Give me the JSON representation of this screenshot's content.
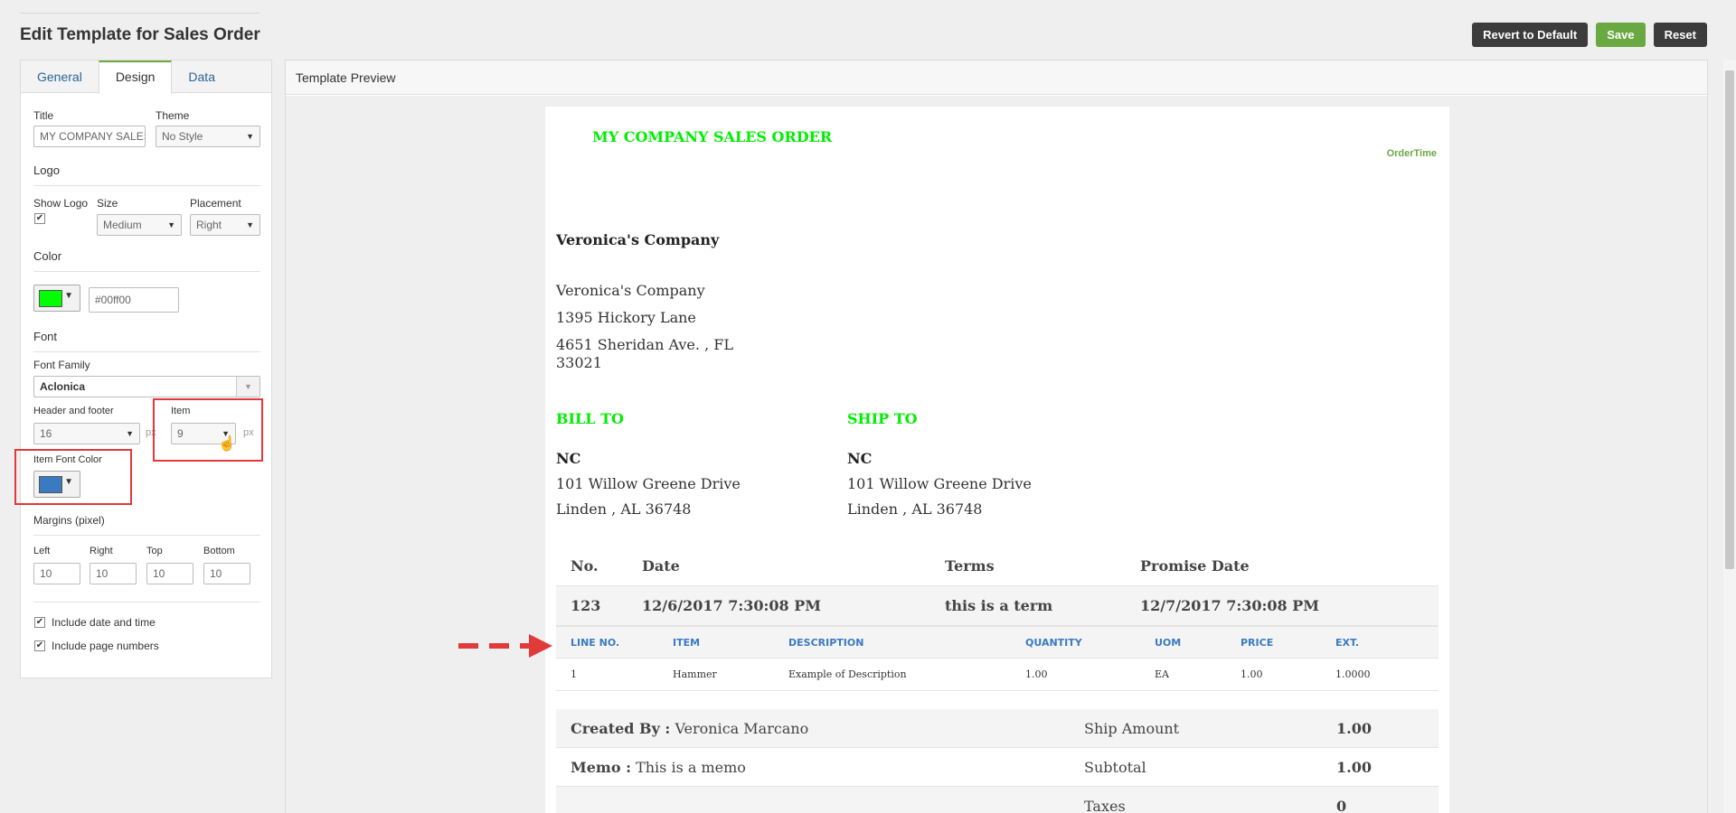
{
  "page": {
    "title": "Edit Template for Sales Order"
  },
  "toolbar": {
    "revert_label": "Revert to Default",
    "save_label": "Save",
    "reset_label": "Reset"
  },
  "tabs": [
    {
      "label": "General"
    },
    {
      "label": "Design"
    },
    {
      "label": "Data"
    }
  ],
  "design": {
    "title_label": "Title",
    "title_value": "MY COMPANY SALES ORDER",
    "theme_label": "Theme",
    "theme_value": "No Style",
    "logo_section": "Logo",
    "show_logo_label": "Show Logo",
    "size_label": "Size",
    "size_value": "Medium",
    "placement_label": "Placement",
    "placement_value": "Right",
    "color_section": "Color",
    "color_hex": "#00ff00",
    "font_section": "Font",
    "font_family_label": "Font Family",
    "font_family_value": "Aclonica",
    "header_footer_label": "Header and footer",
    "header_footer_value": "16",
    "item_label": "Item",
    "item_value": "9",
    "px_unit": "px",
    "item_font_color_label": "Item Font Color",
    "item_font_color": "#3a7ac0",
    "margins_section": "Margins (pixel)",
    "margin_left_label": "Left",
    "margin_right_label": "Right",
    "margin_top_label": "Top",
    "margin_bottom_label": "Bottom",
    "margin_left": "10",
    "margin_right": "10",
    "margin_top": "10",
    "margin_bottom": "10",
    "include_date_label": "Include date and time",
    "include_pages_label": "Include page numbers"
  },
  "preview": {
    "header": "Template Preview",
    "doc_title": "MY COMPANY SALES ORDER",
    "logo_text_a": "OrderTime",
    "company_name": "Veronica's Company",
    "company_addr_1": "Veronica's Company",
    "company_addr_2": "1395 Hickory Lane",
    "company_addr_3": "4651 Sheridan Ave. , FL",
    "company_addr_4": "33021",
    "bill_to": "BILL TO",
    "ship_to": "SHIP TO",
    "bill_name": "NC",
    "bill_line1": "101 Willow Greene Drive",
    "bill_line2": "Linden , AL 36748",
    "ship_name": "NC",
    "ship_line1": "101 Willow Greene Drive",
    "ship_line2": "Linden , AL 36748",
    "info_headers": {
      "no": "No.",
      "date": "Date",
      "terms": "Terms",
      "promise": "Promise Date"
    },
    "info_values": {
      "no": "123",
      "date": "12/6/2017 7:30:08 PM",
      "terms": "this is a term",
      "promise": "12/7/2017 7:30:08 PM"
    },
    "item_headers": {
      "line": "LINE NO.",
      "item": "ITEM",
      "desc": "DESCRIPTION",
      "qty": "QUANTITY",
      "uom": "UOM",
      "price": "PRICE",
      "ext": "EXT."
    },
    "item_row": {
      "line": "1",
      "item": "Hammer",
      "desc": "Example of Description",
      "qty": "1.00",
      "uom": "EA",
      "price": "1.00",
      "ext": "1.0000"
    },
    "created_by_label": "Created By :",
    "created_by_value": "Veronica Marcano",
    "memo_label": "Memo :",
    "memo_value": "This is a memo",
    "ship_amount_label": "Ship Amount",
    "ship_amount_value": "1.00",
    "subtotal_label": "Subtotal",
    "subtotal_value": "1.00",
    "taxes_label": "Taxes",
    "taxes_value": "0"
  },
  "colors": {
    "accent_green": "#00ee00",
    "item_blue": "#3a7ac0",
    "annotation_red": "#e03a3a"
  }
}
